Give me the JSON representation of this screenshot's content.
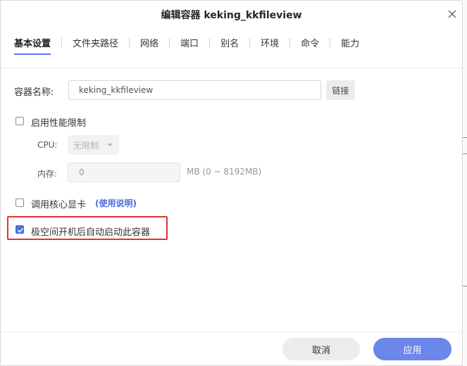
{
  "dialog": {
    "title": "编辑容器 keking_kkfileview"
  },
  "tabs": [
    {
      "label": "基本设置",
      "active": true
    },
    {
      "label": "文件夹路径"
    },
    {
      "label": "网络"
    },
    {
      "label": "端口"
    },
    {
      "label": "别名"
    },
    {
      "label": "环境"
    },
    {
      "label": "命令"
    },
    {
      "label": "能力"
    }
  ],
  "form": {
    "container_name_label": "容器名称:",
    "container_name_value": "keking_kkfileview",
    "link_button": "链接",
    "perf_limit": {
      "label": "启用性能限制",
      "checked": false
    },
    "cpu_label": "CPU:",
    "cpu_value": "无限制",
    "memory_label": "内存:",
    "memory_value": "0",
    "memory_hint": "MB (0 ~ 8192MB)",
    "gpu": {
      "label": "调用核心显卡",
      "checked": false
    },
    "gpu_help": "(使用说明)",
    "autostart": {
      "label": "极空间开机后自动启动此容器",
      "checked": true
    }
  },
  "footer": {
    "cancel": "取消",
    "apply": "应用"
  },
  "colors": {
    "accent": "#4c6fe0",
    "apply_button": "#6b87ea",
    "highlight_border": "#e0342e"
  },
  "icons": [
    "close-icon",
    "check-icon",
    "dropdown-arrow-icon"
  ]
}
